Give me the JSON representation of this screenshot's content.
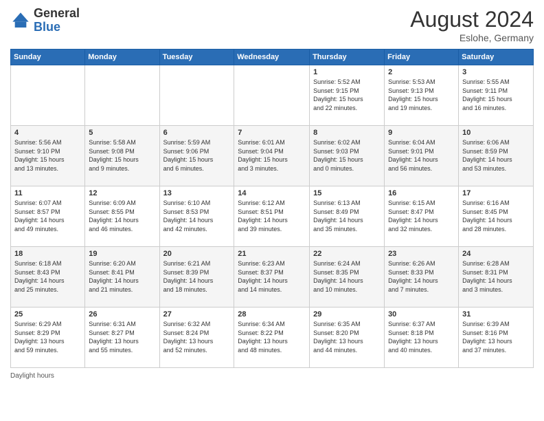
{
  "header": {
    "logo_general": "General",
    "logo_blue": "Blue",
    "month_year": "August 2024",
    "location": "Eslohe, Germany"
  },
  "footer": {
    "note": "Daylight hours"
  },
  "weekdays": [
    "Sunday",
    "Monday",
    "Tuesday",
    "Wednesday",
    "Thursday",
    "Friday",
    "Saturday"
  ],
  "weeks": [
    [
      {
        "day": "",
        "info": ""
      },
      {
        "day": "",
        "info": ""
      },
      {
        "day": "",
        "info": ""
      },
      {
        "day": "",
        "info": ""
      },
      {
        "day": "1",
        "info": "Sunrise: 5:52 AM\nSunset: 9:15 PM\nDaylight: 15 hours\nand 22 minutes."
      },
      {
        "day": "2",
        "info": "Sunrise: 5:53 AM\nSunset: 9:13 PM\nDaylight: 15 hours\nand 19 minutes."
      },
      {
        "day": "3",
        "info": "Sunrise: 5:55 AM\nSunset: 9:11 PM\nDaylight: 15 hours\nand 16 minutes."
      }
    ],
    [
      {
        "day": "4",
        "info": "Sunrise: 5:56 AM\nSunset: 9:10 PM\nDaylight: 15 hours\nand 13 minutes."
      },
      {
        "day": "5",
        "info": "Sunrise: 5:58 AM\nSunset: 9:08 PM\nDaylight: 15 hours\nand 9 minutes."
      },
      {
        "day": "6",
        "info": "Sunrise: 5:59 AM\nSunset: 9:06 PM\nDaylight: 15 hours\nand 6 minutes."
      },
      {
        "day": "7",
        "info": "Sunrise: 6:01 AM\nSunset: 9:04 PM\nDaylight: 15 hours\nand 3 minutes."
      },
      {
        "day": "8",
        "info": "Sunrise: 6:02 AM\nSunset: 9:03 PM\nDaylight: 15 hours\nand 0 minutes."
      },
      {
        "day": "9",
        "info": "Sunrise: 6:04 AM\nSunset: 9:01 PM\nDaylight: 14 hours\nand 56 minutes."
      },
      {
        "day": "10",
        "info": "Sunrise: 6:06 AM\nSunset: 8:59 PM\nDaylight: 14 hours\nand 53 minutes."
      }
    ],
    [
      {
        "day": "11",
        "info": "Sunrise: 6:07 AM\nSunset: 8:57 PM\nDaylight: 14 hours\nand 49 minutes."
      },
      {
        "day": "12",
        "info": "Sunrise: 6:09 AM\nSunset: 8:55 PM\nDaylight: 14 hours\nand 46 minutes."
      },
      {
        "day": "13",
        "info": "Sunrise: 6:10 AM\nSunset: 8:53 PM\nDaylight: 14 hours\nand 42 minutes."
      },
      {
        "day": "14",
        "info": "Sunrise: 6:12 AM\nSunset: 8:51 PM\nDaylight: 14 hours\nand 39 minutes."
      },
      {
        "day": "15",
        "info": "Sunrise: 6:13 AM\nSunset: 8:49 PM\nDaylight: 14 hours\nand 35 minutes."
      },
      {
        "day": "16",
        "info": "Sunrise: 6:15 AM\nSunset: 8:47 PM\nDaylight: 14 hours\nand 32 minutes."
      },
      {
        "day": "17",
        "info": "Sunrise: 6:16 AM\nSunset: 8:45 PM\nDaylight: 14 hours\nand 28 minutes."
      }
    ],
    [
      {
        "day": "18",
        "info": "Sunrise: 6:18 AM\nSunset: 8:43 PM\nDaylight: 14 hours\nand 25 minutes."
      },
      {
        "day": "19",
        "info": "Sunrise: 6:20 AM\nSunset: 8:41 PM\nDaylight: 14 hours\nand 21 minutes."
      },
      {
        "day": "20",
        "info": "Sunrise: 6:21 AM\nSunset: 8:39 PM\nDaylight: 14 hours\nand 18 minutes."
      },
      {
        "day": "21",
        "info": "Sunrise: 6:23 AM\nSunset: 8:37 PM\nDaylight: 14 hours\nand 14 minutes."
      },
      {
        "day": "22",
        "info": "Sunrise: 6:24 AM\nSunset: 8:35 PM\nDaylight: 14 hours\nand 10 minutes."
      },
      {
        "day": "23",
        "info": "Sunrise: 6:26 AM\nSunset: 8:33 PM\nDaylight: 14 hours\nand 7 minutes."
      },
      {
        "day": "24",
        "info": "Sunrise: 6:28 AM\nSunset: 8:31 PM\nDaylight: 14 hours\nand 3 minutes."
      }
    ],
    [
      {
        "day": "25",
        "info": "Sunrise: 6:29 AM\nSunset: 8:29 PM\nDaylight: 13 hours\nand 59 minutes."
      },
      {
        "day": "26",
        "info": "Sunrise: 6:31 AM\nSunset: 8:27 PM\nDaylight: 13 hours\nand 55 minutes."
      },
      {
        "day": "27",
        "info": "Sunrise: 6:32 AM\nSunset: 8:24 PM\nDaylight: 13 hours\nand 52 minutes."
      },
      {
        "day": "28",
        "info": "Sunrise: 6:34 AM\nSunset: 8:22 PM\nDaylight: 13 hours\nand 48 minutes."
      },
      {
        "day": "29",
        "info": "Sunrise: 6:35 AM\nSunset: 8:20 PM\nDaylight: 13 hours\nand 44 minutes."
      },
      {
        "day": "30",
        "info": "Sunrise: 6:37 AM\nSunset: 8:18 PM\nDaylight: 13 hours\nand 40 minutes."
      },
      {
        "day": "31",
        "info": "Sunrise: 6:39 AM\nSunset: 8:16 PM\nDaylight: 13 hours\nand 37 minutes."
      }
    ]
  ]
}
